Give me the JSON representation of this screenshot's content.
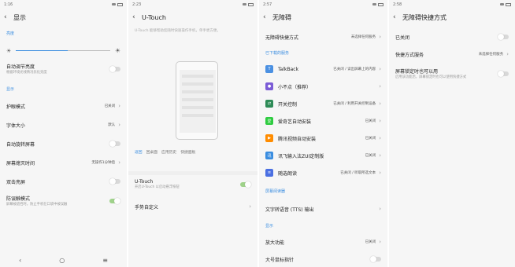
{
  "panel1": {
    "time": "1:16",
    "title": "显示",
    "sec_brightness": "亮度",
    "auto_brightness": "自动调节亮度",
    "auto_brightness_sub": "根据环境光线情况优化亮度",
    "sec_display": "显示",
    "rows": [
      {
        "label": "护眼模式",
        "value": "已关闭"
      },
      {
        "label": "字体大小",
        "value": "默认"
      },
      {
        "label": "自动旋转屏幕",
        "value": ""
      },
      {
        "label": "屏幕熄灭时间",
        "value": "无操作1分钟后"
      },
      {
        "label": "双击亮屏",
        "value": ""
      }
    ],
    "anti_touch": "防误触模式",
    "anti_touch_sub": "屏幕被遮挡时，防止手机在口袋中被误触",
    "nav_back": "‹",
    "nav_home": "○",
    "nav_menu": "≡"
  },
  "panel2": {
    "time": "2:23",
    "title": "U-Touch",
    "desc": "U-Touch 能够帮助您随时快速操作手机，单手更方便。",
    "tabs": [
      "返回",
      "回桌面",
      "应用历史",
      "快捷面板"
    ],
    "utouch_label": "U-Touch",
    "utouch_sub": "开启U-Touch 以启动悬浮按钮",
    "gesture_label": "手势自定义"
  },
  "panel3": {
    "time": "2:57",
    "title": "无障碍",
    "shortcut_label": "无障碍快捷方式",
    "shortcut_value": "未选择任何服务",
    "sec_downloaded": "已下载的服务",
    "services": [
      {
        "label": "TalkBack",
        "value": "已关闭 / 读出屏幕上的内容",
        "color": "#4a90e2",
        "icon": "talkback-icon",
        "glyph": "T"
      },
      {
        "label": "小不点（推荐）",
        "value": "",
        "color": "#7b5cd6",
        "icon": "dot-icon",
        "glyph": "●"
      },
      {
        "label": "开关控制",
        "value": "已关闭 / 利用开关控制设备",
        "color": "#2e8b57",
        "icon": "switch-icon",
        "glyph": "⇄"
      },
      {
        "label": "爱奇艺自动安装",
        "value": "已关闭",
        "color": "#2ecc40",
        "icon": "iqiyi-icon",
        "glyph": "爱"
      },
      {
        "label": "腾讯视频自动安装",
        "value": "已关闭",
        "color": "#ff8c00",
        "icon": "tencent-video-icon",
        "glyph": "▶"
      },
      {
        "label": "讯飞输入法ZUI定制版",
        "value": "已关闭",
        "color": "#3a8de0",
        "icon": "ifly-icon",
        "glyph": "讯"
      },
      {
        "label": "随选朗读",
        "value": "已关闭 / 听取所选文本",
        "color": "#4a6fe2",
        "icon": "select-to-speak-icon",
        "glyph": "≡"
      }
    ],
    "sec_screen_reader": "屏幕阅读器",
    "tts_label": "文字转语音 (TTS) 输出",
    "sec_display": "显示",
    "zoom_label": "放大功能",
    "zoom_value": "已关闭",
    "pointer_label": "大号鼠标指针"
  },
  "panel4": {
    "time": "2:58",
    "title": "无障碍快捷方式",
    "status_label": "已关闭",
    "service_label": "快捷方式服务",
    "service_value": "未选择任何服务",
    "lock_label": "屏幕锁定时也可以用",
    "lock_sub": "启用该功能后，屏幕锁定时也可以使用快捷方式"
  },
  "colors": {
    "accent": "#3a8de0",
    "toggle_on": "#9fd28a"
  }
}
